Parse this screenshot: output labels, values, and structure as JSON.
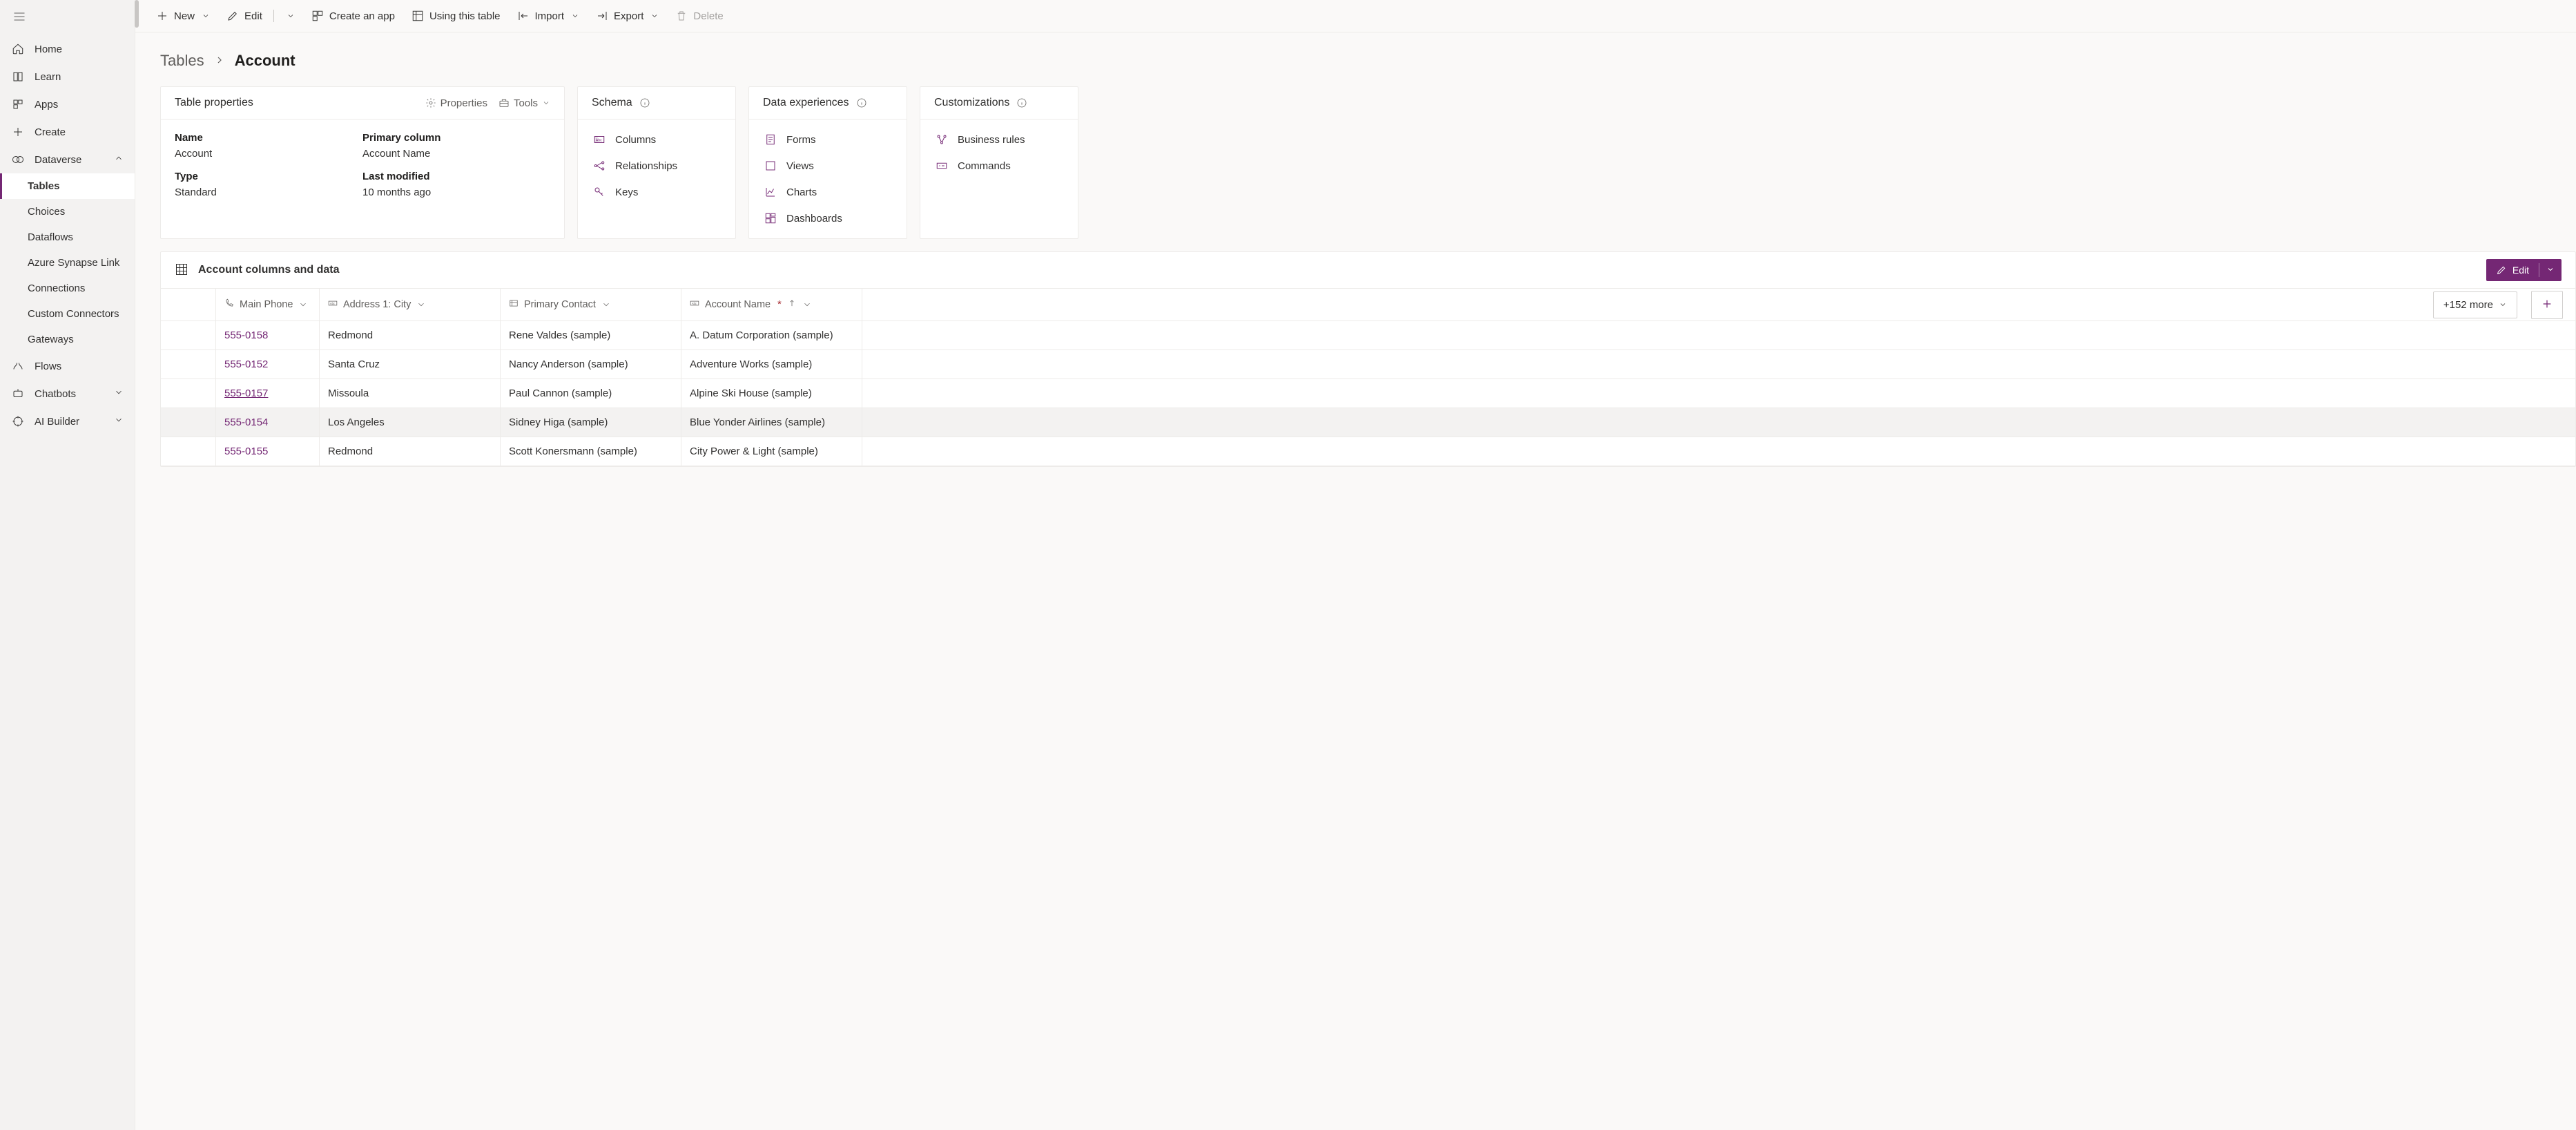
{
  "sidebar": {
    "items": [
      {
        "label": "Home"
      },
      {
        "label": "Learn"
      },
      {
        "label": "Apps"
      },
      {
        "label": "Create"
      },
      {
        "label": "Dataverse"
      },
      {
        "label": "Tables"
      },
      {
        "label": "Choices"
      },
      {
        "label": "Dataflows"
      },
      {
        "label": "Azure Synapse Link"
      },
      {
        "label": "Connections"
      },
      {
        "label": "Custom Connectors"
      },
      {
        "label": "Gateways"
      },
      {
        "label": "Flows"
      },
      {
        "label": "Chatbots"
      },
      {
        "label": "AI Builder"
      }
    ]
  },
  "cmdbar": {
    "new": "New",
    "edit": "Edit",
    "create_app": "Create an app",
    "using_table": "Using this table",
    "import": "Import",
    "export": "Export",
    "delete": "Delete"
  },
  "breadcrumb": {
    "parent": "Tables",
    "current": "Account"
  },
  "props_card": {
    "title": "Table properties",
    "properties_action": "Properties",
    "tools_action": "Tools",
    "name_label": "Name",
    "name_value": "Account",
    "primary_label": "Primary column",
    "primary_value": "Account Name",
    "type_label": "Type",
    "type_value": "Standard",
    "modified_label": "Last modified",
    "modified_value": "10 months ago"
  },
  "schema_card": {
    "title": "Schema",
    "items": [
      "Columns",
      "Relationships",
      "Keys"
    ]
  },
  "exp_card": {
    "title": "Data experiences",
    "items": [
      "Forms",
      "Views",
      "Charts",
      "Dashboards"
    ]
  },
  "cust_card": {
    "title": "Customizations",
    "items": [
      "Business rules",
      "Commands"
    ]
  },
  "grid": {
    "title": "Account columns and data",
    "edit_label": "Edit",
    "more_label": "+152 more",
    "columns": {
      "phone": "Main Phone",
      "city": "Address 1: City",
      "contact": "Primary Contact",
      "name": "Account Name"
    },
    "rows": [
      {
        "phone": "555-0158",
        "city": "Redmond",
        "contact": "Rene Valdes (sample)",
        "name": "A. Datum Corporation (sample)"
      },
      {
        "phone": "555-0152",
        "city": "Santa Cruz",
        "contact": "Nancy Anderson (sample)",
        "name": "Adventure Works (sample)"
      },
      {
        "phone": "555-0157",
        "city": "Missoula",
        "contact": "Paul Cannon (sample)",
        "name": "Alpine Ski House (sample)"
      },
      {
        "phone": "555-0154",
        "city": "Los Angeles",
        "contact": "Sidney Higa (sample)",
        "name": "Blue Yonder Airlines (sample)"
      },
      {
        "phone": "555-0155",
        "city": "Redmond",
        "contact": "Scott Konersmann (sample)",
        "name": "City Power & Light (sample)"
      }
    ]
  }
}
